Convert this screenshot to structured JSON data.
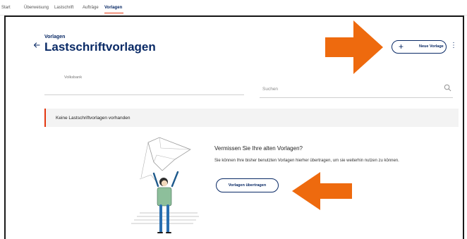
{
  "nav": {
    "tabs": [
      {
        "label": "Start"
      },
      {
        "label": "Überweisung"
      },
      {
        "label": "Lastschrift"
      },
      {
        "label": "Aufträge"
      },
      {
        "label": "Vorlagen",
        "active": true
      }
    ]
  },
  "header": {
    "breadcrumb": "Vorlagen",
    "title": "Lastschriftvorlagen",
    "back_icon": "arrow-left-icon",
    "new_template_button": "Neue Vorlage",
    "new_template_icon": "plus-icon",
    "more_icon": "kebab-menu-icon"
  },
  "filters": {
    "account_label": "Volksbank",
    "search_placeholder": "Suchen",
    "search_icon": "search-icon"
  },
  "notice": {
    "text": "Keine Lastschriftvorlagen vorhanden"
  },
  "migration": {
    "title": "Vermissen Sie Ihre alten Vorlagen?",
    "text": "Sie können Ihre bisher benutzten Vorlagen hierher übertragen, um sie weiterhin nutzen zu können.",
    "button": "Vorlagen übertragen"
  },
  "colors": {
    "brand_navy": "#0a2a66",
    "accent_red": "#e3360f",
    "annotation_orange": "#ee6a0e"
  }
}
